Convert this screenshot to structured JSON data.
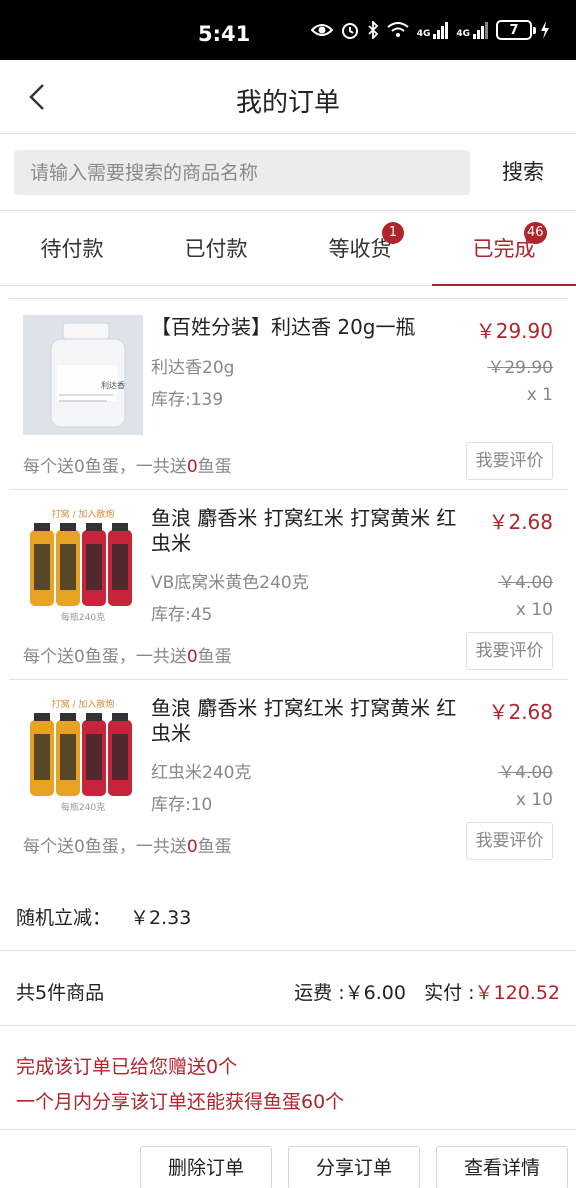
{
  "status_bar": {
    "time": "5:41",
    "battery": "7",
    "network_1": "4G",
    "network_2": "4G"
  },
  "header": {
    "title": "我的订单"
  },
  "search": {
    "placeholder": "请输入需要搜索的商品名称",
    "button": "搜索"
  },
  "tabs": [
    {
      "label": "待付款",
      "badge": ""
    },
    {
      "label": "已付款",
      "badge": ""
    },
    {
      "label": "等收货",
      "badge": "1"
    },
    {
      "label": "已完成",
      "badge": "46",
      "active": true
    }
  ],
  "items": [
    {
      "name": "【百姓分装】利达香 20g一瓶",
      "price": "￥29.90",
      "spec": "利达香20g",
      "old_price": "￥29.90",
      "stock": "库存:139",
      "qty": "x 1",
      "gift_prefix": "每个送0鱼蛋，一共送",
      "gift_count": "0",
      "gift_suffix": "鱼蛋",
      "review": "我要评价",
      "image_label": "利达香"
    },
    {
      "name": "鱼浪 麝香米 打窝红米 打窝黄米 红虫米",
      "price": "￥2.68",
      "spec": "VB底窝米黄色240克",
      "old_price": "￥4.00",
      "stock": "库存:45",
      "qty": "x 10",
      "gift_prefix": "每个送0鱼蛋，一共送",
      "gift_count": "0",
      "gift_suffix": "鱼蛋",
      "review": "我要评价",
      "image_top": "打窝 / 加入散炮",
      "image_bottom": "每瓶240克"
    },
    {
      "name": "鱼浪 麝香米 打窝红米 打窝黄米 红虫米",
      "price": "￥2.68",
      "spec": "红虫米240克",
      "old_price": "￥4.00",
      "stock": "库存:10",
      "qty": "x 10",
      "gift_prefix": "每个送0鱼蛋，一共送",
      "gift_count": "0",
      "gift_suffix": "鱼蛋",
      "review": "我要评价",
      "image_top": "打窝 / 加入散炮",
      "image_bottom": "每瓶240克"
    }
  ],
  "discount": {
    "label": "随机立减：",
    "value": "￥2.33"
  },
  "summary": {
    "count": "共5件商品",
    "shipping_label": "运费 :",
    "shipping": "￥6.00",
    "paid_label": "实付 :",
    "paid": "￥120.52"
  },
  "promo": {
    "line1": "完成该订单已给您赠送0个",
    "line2": "一个月内分享该订单还能获得鱼蛋60个"
  },
  "actions": {
    "delete": "删除订单",
    "share": "分享订单",
    "details": "查看详情"
  },
  "colors": {
    "accent": "#b0242c",
    "muted": "#888888",
    "divider": "#e2e2e2"
  }
}
